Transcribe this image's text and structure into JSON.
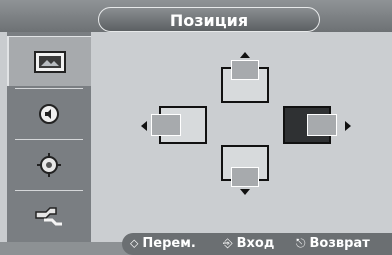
{
  "header": {
    "title": "Позиция"
  },
  "sidebar": {
    "items": [
      {
        "name": "picture",
        "icon": "picture-icon",
        "active": true
      },
      {
        "name": "sound",
        "icon": "sound-icon",
        "active": false
      },
      {
        "name": "setup",
        "icon": "gear-icon",
        "active": false
      },
      {
        "name": "input",
        "icon": "input-plug-icon",
        "active": false
      }
    ]
  },
  "position_controls": {
    "up": "up-arrow-icon",
    "left": "left-arrow-icon",
    "right": "right-arrow-icon",
    "down": "down-arrow-icon",
    "selected": "right"
  },
  "footer": {
    "hints": [
      {
        "icon": "move-icon",
        "label": "Перем."
      },
      {
        "icon": "enter-icon",
        "label": "Вход"
      },
      {
        "icon": "return-icon",
        "label": "Возврат"
      }
    ]
  },
  "colors": {
    "accent": "#6b6f72",
    "text": "#ffffff"
  }
}
